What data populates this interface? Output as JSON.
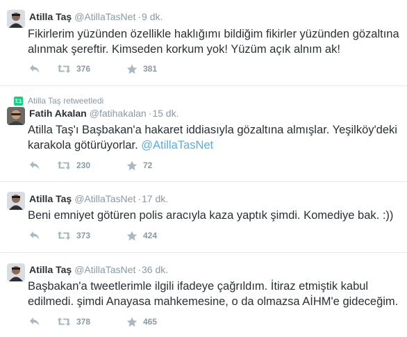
{
  "tweets": [
    {
      "fullname": "Atilla Taş",
      "username": "@AtillaTasNet",
      "time": "9 dk.",
      "text": "Fikirlerim yüzünden özellikle haklığımı bildiğim fikirler yüzünden gözaltına alınmak şereftir. Kimseden korkum yok! Yüzüm açık alnım ak!",
      "retweets": "376",
      "favorites": "381"
    },
    {
      "context": "Atilla Taş retweetledi",
      "fullname": "Fatih Akalan",
      "username": "@fatihakalan",
      "time": "15 dk.",
      "text": "Atilla Taş'ı Başbakan'a hakaret iddiasıyla gözaltına almışlar. Yeşilköy'deki karakola götürüyorlar.",
      "mention": "@AtillaTasNet",
      "retweets": "230",
      "favorites": "72"
    },
    {
      "fullname": "Atilla Taş",
      "username": "@AtillaTasNet",
      "time": "17 dk.",
      "text": "Beni emniyet götüren polis aracıyla kaza yaptık şimdi. Komediye bak. :))",
      "retweets": "373",
      "favorites": "424"
    },
    {
      "fullname": "Atilla Taş",
      "username": "@AtillaTasNet",
      "time": "36 dk.",
      "text": "Başbakan'a tweetlerimle  ilgili ifadeye çağrıldım. İtiraz etmiştik kabul edilmedi. şimdi Anayasa mahkemesine, o da olmazsa AİHM'e gideceğim.",
      "retweets": "378",
      "favorites": "465"
    }
  ],
  "colors": {
    "link": "#55acee",
    "muted": "#8899a6",
    "icon": "#aab8c2",
    "retweet_badge": "#19cf86",
    "text": "#292f33"
  },
  "icons": {
    "reply": "reply-icon",
    "retweet": "retweet-icon",
    "favorite": "star-icon",
    "context": "retweeted-badge-icon"
  },
  "separator": "·"
}
